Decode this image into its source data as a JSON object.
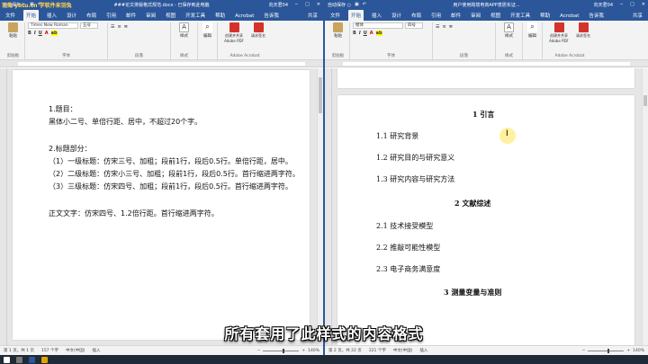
{
  "watermark": "羽兔 yutu.cn 学软件来羽兔",
  "left_window": {
    "quick_access": "自动保存 ○",
    "title": "###论文排版格式规范.docx - 已保存到此电脑",
    "user": "向天君04",
    "tabs": [
      "文件",
      "开始",
      "插入",
      "设计",
      "布局",
      "引用",
      "邮件",
      "审阅",
      "视图",
      "开发工具",
      "帮助",
      "Acrobat"
    ],
    "active_tab": "开始",
    "tell_me": "告诉我",
    "share": "共享",
    "font_name": "Times New Roman",
    "font_size": "五号",
    "ribbon": {
      "paste": "粘贴",
      "clipboard": "剪贴板",
      "font": "字体",
      "paragraph": "段落",
      "styles": "样式",
      "styles_group": "样式",
      "editing": "编辑",
      "create_pdf": "创建并共享 Adobe PDF",
      "request_sig": "请求签名",
      "acrobat_group": "Adobe Acrobat"
    },
    "doc_lines": [
      "1.题目：",
      "黑体小二号、单倍行距、居中，不超过20个字。",
      "2.标题部分：",
      "（1）一级标题：仿宋三号、加粗；段前1行，段后0.5行。单倍行距，居中。",
      "（2）二级标题：仿宋小三号、加粗；段前1行，段后0.5行。首行缩进两字符。",
      "（3）三级标题：仿宋四号、加粗；段前1行，段后0.5行。首行缩进两字符。",
      "正文文字：仿宋四号、1.2倍行距。首行缩进两字符。"
    ],
    "status": {
      "page": "第 1 页，共 1 页",
      "words": "157 个字",
      "lang": "中文(中国)",
      "mode": "插入",
      "zoom": "140%"
    }
  },
  "right_window": {
    "quick_access": "自动保存 ○",
    "title": "用户使用跨境电商APP意愿实证...",
    "user": "向天君04",
    "tabs": [
      "文件",
      "开始",
      "插入",
      "设计",
      "布局",
      "引用",
      "邮件",
      "审阅",
      "视图",
      "开发工具",
      "帮助",
      "Acrobat"
    ],
    "active_tab": "开始",
    "tell_me": "告诉我",
    "share": "共享",
    "font_name": "楷体",
    "font_size": "四号",
    "ribbon": {
      "paste": "粘贴",
      "clipboard": "剪贴板",
      "font": "字体",
      "paragraph": "段落",
      "styles": "样式",
      "styles_group": "样式",
      "editing": "编辑",
      "create_pdf": "创建并共享 Adobe PDF",
      "request_sig": "请求签名",
      "acrobat_group": "Adobe Acrobat"
    },
    "doc_lines": [
      {
        "text": "1 引言",
        "level": 1
      },
      {
        "text": "1.1 研究背景",
        "level": 2
      },
      {
        "text": "1.2 研究目的与研究意义",
        "level": 2
      },
      {
        "text": "1.3 研究内容与研究方法",
        "level": 2
      },
      {
        "text": "2 文献综述",
        "level": 1
      },
      {
        "text": "2.1 技术接受模型",
        "level": 2
      },
      {
        "text": "2.2 推敲可能性模型",
        "level": 2
      },
      {
        "text": "2.3 电子商务满意度",
        "level": 2
      },
      {
        "text": "3 测量变量与准则",
        "level": 1
      }
    ],
    "status": {
      "page": "第 2 页，共 22 页",
      "words": "221 个字",
      "lang": "中文(中国)",
      "mode": "插入",
      "zoom": "140%"
    }
  },
  "caption": "所有套用了此样式的内容格式",
  "colors": {
    "word_blue": "#2b579a",
    "ribbon_bg": "#f3f3f3",
    "doc_bg": "#e6e6e6",
    "highlight": "#ffe650"
  }
}
